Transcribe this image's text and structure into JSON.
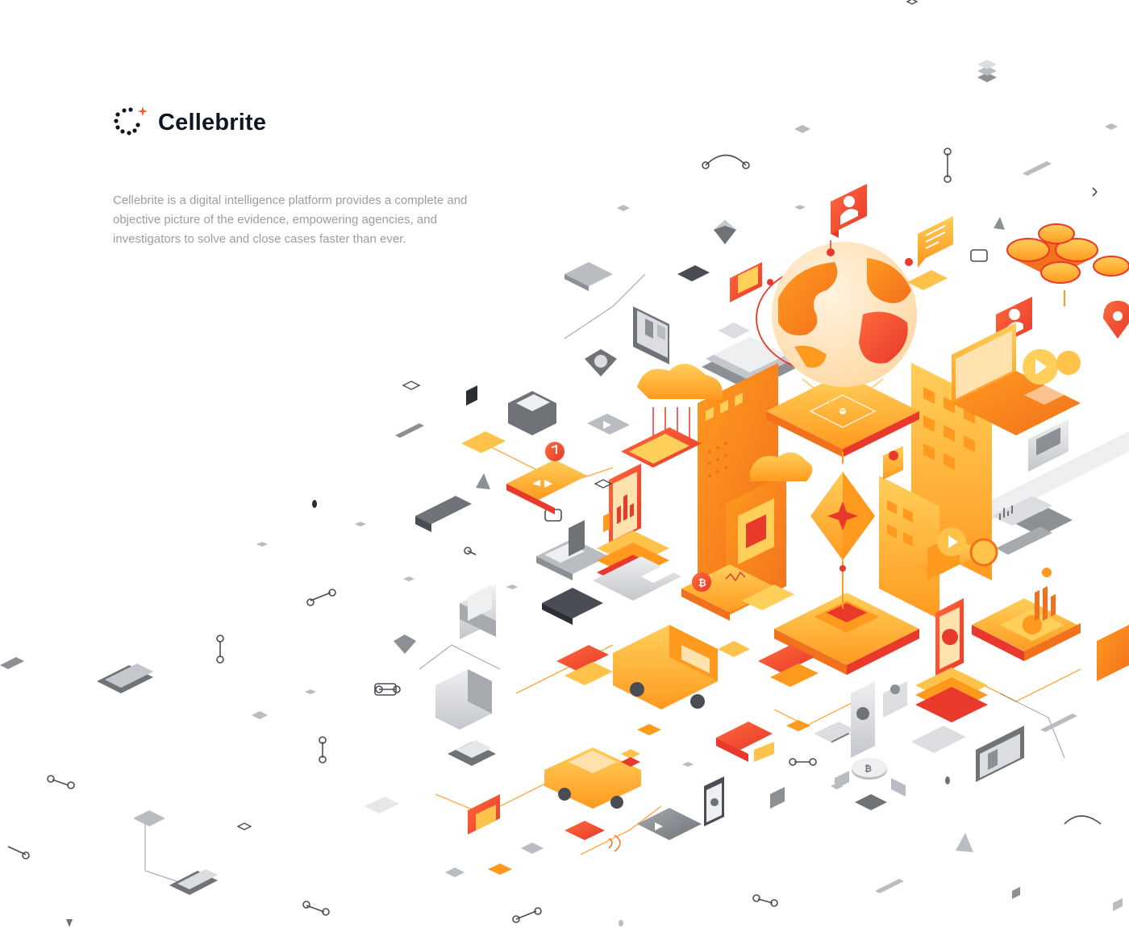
{
  "brand": {
    "name": "Cellebrite",
    "logo_icon": "cellebrite-dots-logo",
    "accent_color": "#f15a24",
    "text_color": "#0f1623"
  },
  "intro": {
    "description": "Cellebrite is a digital intelligence platform provides a complete and objective picture of the evidence, empowering agencies, and investigators to solve and close cases faster than ever."
  },
  "illustration": {
    "style": "isometric",
    "palette": {
      "orange_light": "#ffc24a",
      "orange": "#ff9a1f",
      "orange_dark": "#f2711c",
      "red": "#e8392b",
      "gray_light": "#e6e7e9",
      "gray": "#b9bcc0",
      "gray_dark": "#6f7378"
    },
    "icons": [
      "globe-icon",
      "drone-icon",
      "car-icon",
      "van-icon",
      "phone-icon",
      "laptop-icon",
      "bitcoin-icon",
      "cloud-icon",
      "wallet-icon",
      "security-camera-icon",
      "location-pin-icon",
      "user-profile-icon",
      "chat-bubble-icon",
      "music-icon",
      "bar-chart-icon",
      "pie-chart-icon",
      "central-star-crystal-icon"
    ]
  }
}
